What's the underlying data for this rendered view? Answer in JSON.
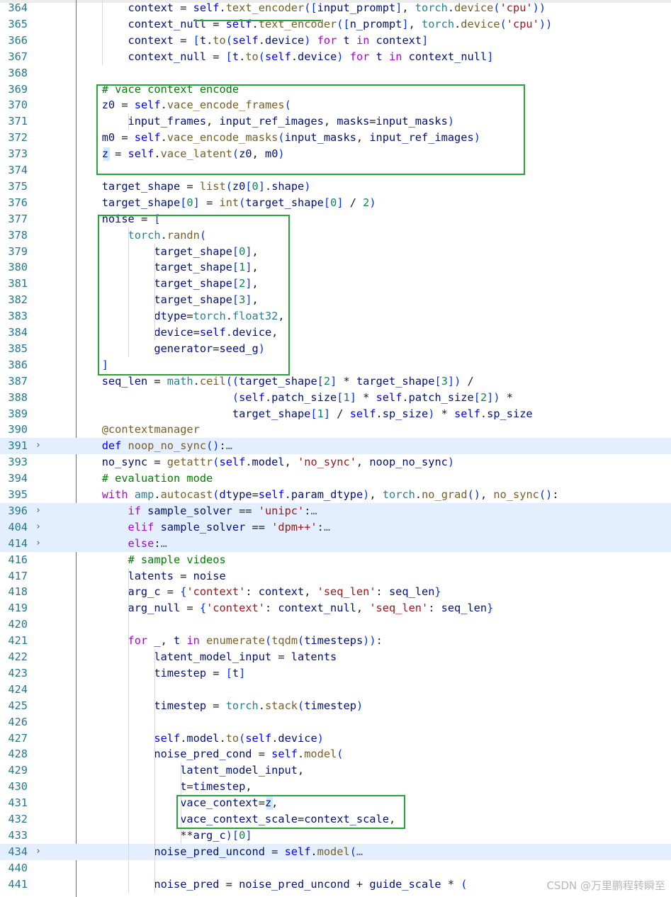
{
  "editor": {
    "lines": [
      {
        "n": "364",
        "code": "            context = self.text_encoder([input_prompt], torch.device('cpu'))"
      },
      {
        "n": "365",
        "code": "            context_null = self.text_encoder([n_prompt], torch.device('cpu'))"
      },
      {
        "n": "366",
        "code": "            context = [t.to(self.device) for t in context]"
      },
      {
        "n": "367",
        "code": "            context_null = [t.to(self.device) for t in context_null]"
      },
      {
        "n": "368",
        "code": ""
      },
      {
        "n": "369",
        "code": "        # vace context encode"
      },
      {
        "n": "370",
        "code": "        z0 = self.vace_encode_frames("
      },
      {
        "n": "371",
        "code": "            input_frames, input_ref_images, masks=input_masks)"
      },
      {
        "n": "372",
        "code": "        m0 = self.vace_encode_masks(input_masks, input_ref_images)"
      },
      {
        "n": "373",
        "code": "        z = self.vace_latent(z0, m0)"
      },
      {
        "n": "374",
        "code": ""
      },
      {
        "n": "375",
        "code": "        target_shape = list(z0[0].shape)"
      },
      {
        "n": "376",
        "code": "        target_shape[0] = int(target_shape[0] / 2)"
      },
      {
        "n": "377",
        "code": "        noise = ["
      },
      {
        "n": "378",
        "code": "            torch.randn("
      },
      {
        "n": "379",
        "code": "                target_shape[0],"
      },
      {
        "n": "380",
        "code": "                target_shape[1],"
      },
      {
        "n": "381",
        "code": "                target_shape[2],"
      },
      {
        "n": "382",
        "code": "                target_shape[3],"
      },
      {
        "n": "383",
        "code": "                dtype=torch.float32,"
      },
      {
        "n": "384",
        "code": "                device=self.device,"
      },
      {
        "n": "385",
        "code": "                generator=seed_g)"
      },
      {
        "n": "386",
        "code": "        ]"
      },
      {
        "n": "387",
        "code": "        seq_len = math.ceil((target_shape[2] * target_shape[3]) /"
      },
      {
        "n": "388",
        "code": "                            (self.patch_size[1] * self.patch_size[2]) *"
      },
      {
        "n": "389",
        "code": "                            target_shape[1] / self.sp_size) * self.sp_size"
      },
      {
        "n": "390",
        "code": "        @contextmanager"
      },
      {
        "n": "391",
        "code": "        def noop_no_sync():…",
        "folded": true
      },
      {
        "n": "393",
        "code": "        no_sync = getattr(self.model, 'no_sync', noop_no_sync)"
      },
      {
        "n": "394",
        "code": "        # evaluation mode"
      },
      {
        "n": "395",
        "code": "        with amp.autocast(dtype=self.param_dtype), torch.no_grad(), no_sync():"
      },
      {
        "n": "396",
        "code": "            if sample_solver == 'unipc':…",
        "folded": true
      },
      {
        "n": "404",
        "code": "            elif sample_solver == 'dpm++':…",
        "folded": true
      },
      {
        "n": "414",
        "code": "            else:…",
        "folded": true
      },
      {
        "n": "416",
        "code": "            # sample videos"
      },
      {
        "n": "417",
        "code": "            latents = noise"
      },
      {
        "n": "418",
        "code": "            arg_c = {'context': context, 'seq_len': seq_len}"
      },
      {
        "n": "419",
        "code": "            arg_null = {'context': context_null, 'seq_len': seq_len}"
      },
      {
        "n": "420",
        "code": ""
      },
      {
        "n": "421",
        "code": "            for _, t in enumerate(tqdm(timesteps)):"
      },
      {
        "n": "422",
        "code": "                latent_model_input = latents"
      },
      {
        "n": "423",
        "code": "                timestep = [t]"
      },
      {
        "n": "424",
        "code": ""
      },
      {
        "n": "425",
        "code": "                timestep = torch.stack(timestep)"
      },
      {
        "n": "426",
        "code": ""
      },
      {
        "n": "427",
        "code": "                self.model.to(self.device)"
      },
      {
        "n": "428",
        "code": "                noise_pred_cond = self.model("
      },
      {
        "n": "429",
        "code": "                    latent_model_input,"
      },
      {
        "n": "430",
        "code": "                    t=timestep,"
      },
      {
        "n": "431",
        "code": "                    vace_context=z,"
      },
      {
        "n": "432",
        "code": "                    vace_context_scale=context_scale,"
      },
      {
        "n": "433",
        "code": "                    **arg_c)[0]"
      },
      {
        "n": "434",
        "code": "                noise_pred_uncond = self.model(…",
        "folded": true
      },
      {
        "n": "440",
        "code": ""
      },
      {
        "n": "441",
        "code": "                noise_pred = noise_pred_uncond + guide_scale * ("
      }
    ]
  },
  "watermark": "CSDN @万里鹏程转瞬至",
  "colors": {
    "keyword": "#0000ff",
    "control": "#af00db",
    "function": "#795e26",
    "module": "#267f99",
    "string": "#a31515",
    "comment": "#008000",
    "annotation_box": "#27a33a",
    "folded_bg": "#e3efff",
    "line_number": "#237893"
  },
  "icons": {
    "fold": "chevron-right-icon"
  }
}
